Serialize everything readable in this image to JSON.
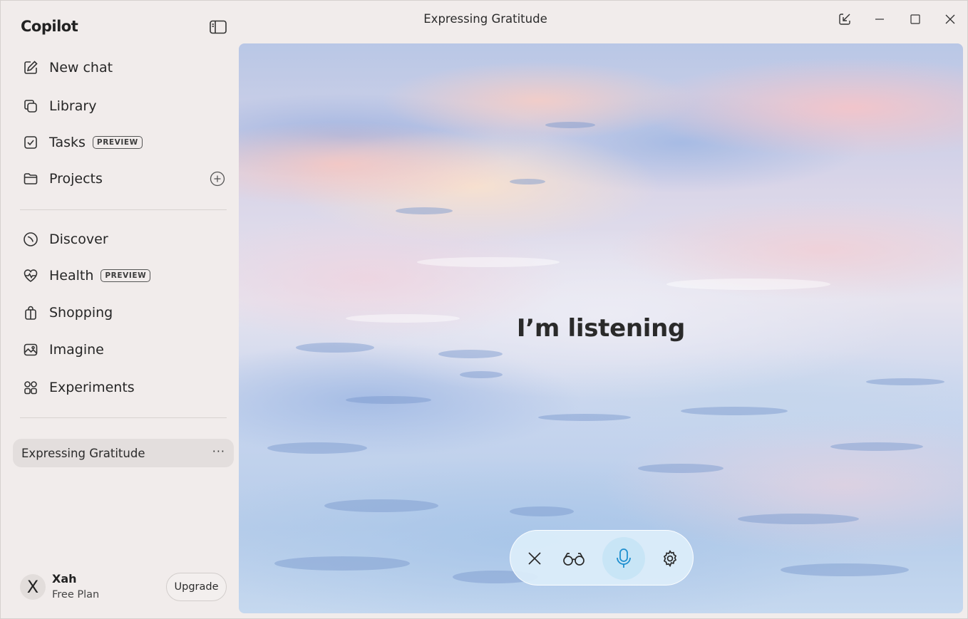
{
  "app": {
    "brand": "Copilot",
    "window_title": "Expressing Gratitude"
  },
  "sidebar": {
    "items_top": [
      {
        "label": "New chat",
        "icon": "compose-icon"
      },
      {
        "label": "Library",
        "icon": "library-icon"
      },
      {
        "label": "Tasks",
        "badge": "PREVIEW",
        "icon": "task-checkbox-icon"
      },
      {
        "label": "Projects",
        "icon": "folder-icon"
      }
    ],
    "items_bottom": [
      {
        "label": "Discover",
        "icon": "compass-icon"
      },
      {
        "label": "Health",
        "badge": "PREVIEW",
        "icon": "heart-pulse-icon"
      },
      {
        "label": "Shopping",
        "icon": "shopping-bag-icon"
      },
      {
        "label": "Imagine",
        "icon": "image-sparkle-icon"
      },
      {
        "label": "Experiments",
        "icon": "grid-icon"
      }
    ],
    "conversations": [
      {
        "title": "Expressing Gratitude",
        "more": "···"
      }
    ],
    "user": {
      "initial": "X",
      "name": "Xah",
      "plan": "Free Plan",
      "upgrade_label": "Upgrade"
    }
  },
  "stage": {
    "status_text": "I’m listening",
    "controls": [
      {
        "name": "close-voice-button",
        "icon": "close-icon"
      },
      {
        "name": "vision-button",
        "icon": "glasses-icon"
      },
      {
        "name": "microphone-button",
        "icon": "microphone-icon",
        "active": true
      },
      {
        "name": "settings-button",
        "icon": "gear-icon"
      }
    ]
  },
  "colors": {
    "accent": "#1f8fcf",
    "sidebar_bg": "#f1eceb",
    "selected_item": "#e3dedd"
  }
}
